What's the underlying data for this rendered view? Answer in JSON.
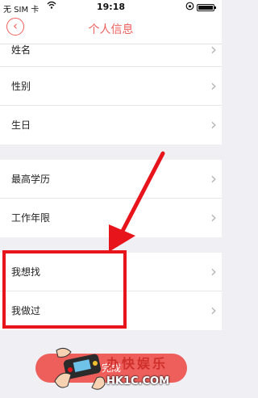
{
  "status_bar": {
    "carrier": "无 SIM 卡",
    "wifi_icon": "wifi-icon",
    "time": "19:18",
    "lock_icon": "orientation-lock-icon",
    "battery_icon": "battery-icon"
  },
  "nav": {
    "back_icon": "back-chevron-icon",
    "back_glyph": "‹",
    "title": "个人信息"
  },
  "section_basic": {
    "rows": [
      {
        "label": "姓名"
      },
      {
        "label": "性别"
      },
      {
        "label": "生日"
      }
    ]
  },
  "section_education": {
    "rows": [
      {
        "label": "最高学历"
      },
      {
        "label": "工作年限"
      }
    ]
  },
  "section_job": {
    "rows": [
      {
        "label": "我想找"
      },
      {
        "label": "我做过"
      }
    ]
  },
  "chevron_glyph": "›",
  "done_button": {
    "label": "完成"
  },
  "watermark": {
    "brand": "办快娱乐",
    "site": "HK1C.COM"
  },
  "colors": {
    "accent": "#ee5f5b",
    "annotation_red": "#e8141c",
    "background": "#efeff4"
  }
}
